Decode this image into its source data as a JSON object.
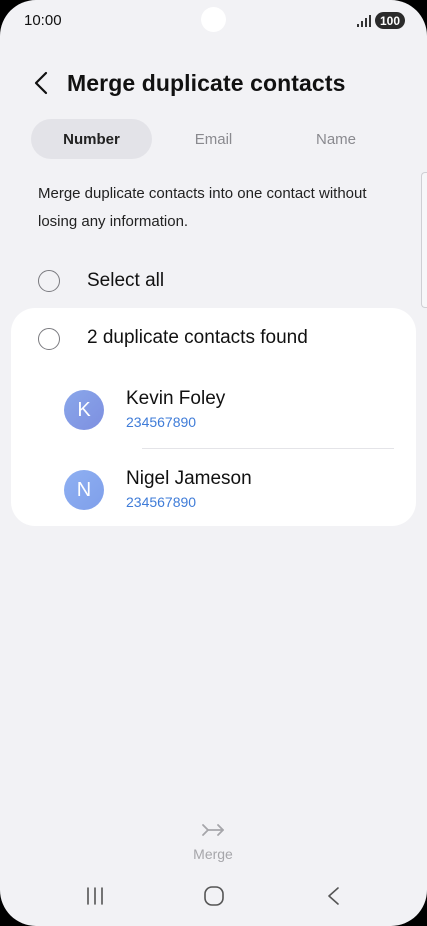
{
  "status_bar": {
    "time": "10:00",
    "battery": "100"
  },
  "header": {
    "title": "Merge duplicate contacts"
  },
  "tabs": [
    {
      "label": "Number",
      "active": true
    },
    {
      "label": "Email",
      "active": false
    },
    {
      "label": "Name",
      "active": false
    }
  ],
  "description": "Merge duplicate contacts into one contact without losing any information.",
  "select_all": {
    "label": "Select all",
    "checked": false
  },
  "duplicate_group": {
    "label": "2 duplicate contacts found",
    "checked": false,
    "contacts": [
      {
        "initial": "K",
        "name": "Kevin Foley",
        "number": "234567890"
      },
      {
        "initial": "N",
        "name": "Nigel Jameson",
        "number": "234567890"
      }
    ]
  },
  "merge_button": {
    "label": "Merge",
    "enabled": false
  },
  "colors": {
    "background": "#f2f2f5",
    "card": "#ffffff",
    "link_blue": "#3f7cd8",
    "avatar": "#8aa7ea",
    "disabled": "#a6a6aa"
  }
}
